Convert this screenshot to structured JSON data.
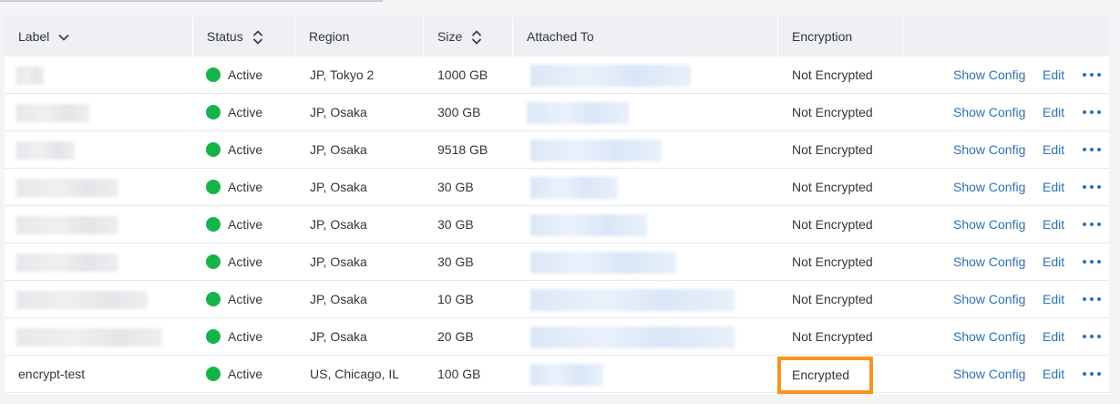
{
  "headers": {
    "label": "Label",
    "status": "Status",
    "region": "Region",
    "size": "Size",
    "attached_to": "Attached To",
    "encryption": "Encryption"
  },
  "actions": {
    "show_config": "Show Config",
    "edit": "Edit"
  },
  "status_color": "#17b24a",
  "link_color": "#2c72b6",
  "highlight_color": "#f7941d",
  "rows": [
    {
      "label": "",
      "status": "Active",
      "region": "JP, Tokyo 2",
      "size": "1000 GB",
      "attached_to": "",
      "encryption": "Not Encrypted"
    },
    {
      "label": "",
      "status": "Active",
      "region": "JP, Osaka",
      "size": "300 GB",
      "attached_to": "",
      "encryption": "Not Encrypted"
    },
    {
      "label": "",
      "status": "Active",
      "region": "JP, Osaka",
      "size": "9518 GB",
      "attached_to": "",
      "encryption": "Not Encrypted"
    },
    {
      "label": "",
      "status": "Active",
      "region": "JP, Osaka",
      "size": "30 GB",
      "attached_to": "",
      "encryption": "Not Encrypted"
    },
    {
      "label": "",
      "status": "Active",
      "region": "JP, Osaka",
      "size": "30 GB",
      "attached_to": "",
      "encryption": "Not Encrypted"
    },
    {
      "label": "",
      "status": "Active",
      "region": "JP, Osaka",
      "size": "30 GB",
      "attached_to": "",
      "encryption": "Not Encrypted"
    },
    {
      "label": "",
      "status": "Active",
      "region": "JP, Osaka",
      "size": "10 GB",
      "attached_to": "",
      "encryption": "Not Encrypted"
    },
    {
      "label": "",
      "status": "Active",
      "region": "JP, Osaka",
      "size": "20 GB",
      "attached_to": "",
      "encryption": "Not Encrypted"
    },
    {
      "label": "encrypt-test",
      "status": "Active",
      "region": "US, Chicago, IL",
      "size": "100 GB",
      "attached_to": "",
      "encryption": "Encrypted"
    }
  ]
}
